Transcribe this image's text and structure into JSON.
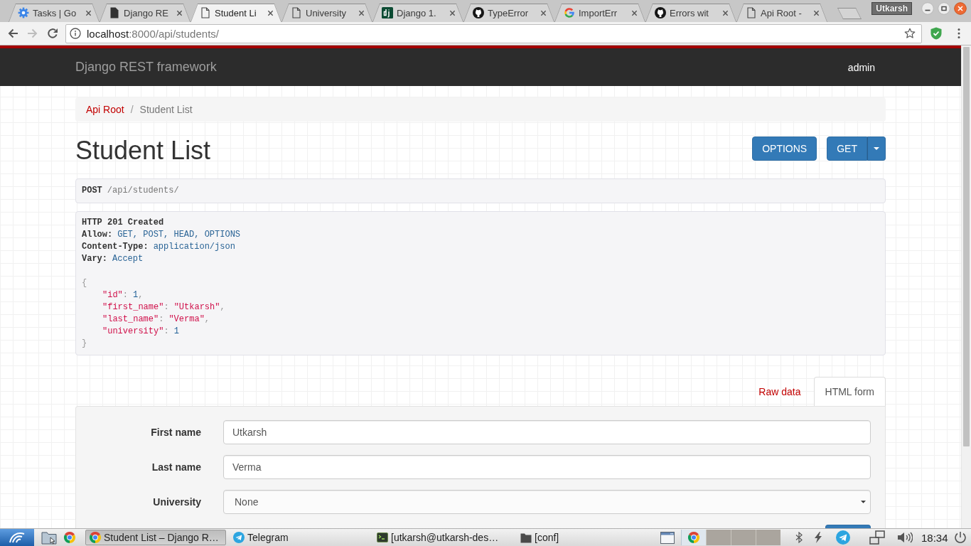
{
  "browser": {
    "tabs": [
      {
        "title": "Tasks | Go",
        "kind": "gear",
        "selected": false
      },
      {
        "title": "Django RE",
        "kind": "doc-filled",
        "selected": false
      },
      {
        "title": "Student Li",
        "kind": "doc",
        "selected": true
      },
      {
        "title": "University",
        "kind": "doc",
        "selected": false
      },
      {
        "title": "Django 1.",
        "kind": "tile",
        "selected": false
      },
      {
        "title": "TypeError",
        "kind": "cat",
        "selected": false
      },
      {
        "title": "ImportErr",
        "kind": "g",
        "selected": false
      },
      {
        "title": "Errors wit",
        "kind": "cat",
        "selected": false
      },
      {
        "title": "Api Root -",
        "kind": "doc",
        "selected": false
      }
    ],
    "profile": "Utkarsh",
    "nav_buttons": [
      {
        "kind": "back",
        "disabled": false
      },
      {
        "kind": "forward",
        "disabled": true
      },
      {
        "kind": "reload",
        "disabled": false
      }
    ],
    "url": {
      "host": "localhost",
      "path": ":8000/api/students/"
    }
  },
  "navbar": {
    "brand": "Django REST framework",
    "user": "admin"
  },
  "breadcrumbs": [
    {
      "label": "Api Root",
      "kind": "link"
    },
    {
      "label": "/",
      "kind": "separator"
    },
    {
      "label": "Student List",
      "kind": "current"
    }
  ],
  "page_title": "Student List",
  "actions": [
    {
      "label": "OPTIONS",
      "kind": "button"
    },
    {
      "label": "GET",
      "kind": "split"
    }
  ],
  "request": {
    "method": "POST",
    "path": "/api/students/"
  },
  "response": {
    "status": "HTTP 201 Created",
    "headers": [
      {
        "name": "Allow:",
        "value": "GET, POST, HEAD, OPTIONS"
      },
      {
        "name": "Content-Type:",
        "value": "application/json"
      },
      {
        "name": "Vary:",
        "value": "Accept"
      }
    ],
    "body": {
      "open": "{",
      "fields": [
        {
          "key": "\"id\"",
          "colon": ":",
          "value": "1",
          "kind": "number",
          "comma": ","
        },
        {
          "key": "\"first_name\"",
          "colon": ":",
          "value": "\"Utkarsh\"",
          "kind": "string",
          "comma": ","
        },
        {
          "key": "\"last_name\"",
          "colon": ":",
          "value": "\"Verma\"",
          "kind": "string",
          "comma": ","
        },
        {
          "key": "\"university\"",
          "colon": ":",
          "value": "1",
          "kind": "number"
        }
      ],
      "close": "}"
    }
  },
  "form_tabs": [
    {
      "label": "Raw data",
      "selected": false
    },
    {
      "label": "HTML form",
      "selected": true
    }
  ],
  "form": {
    "fields": [
      {
        "label": "First name",
        "kind": "text",
        "value": "Utkarsh"
      },
      {
        "label": "Last name",
        "kind": "text",
        "value": "Verma"
      },
      {
        "label": "University",
        "kind": "select",
        "value": "None"
      }
    ]
  },
  "taskbar": {
    "tasks": [
      {
        "title": "Student List – Django R…",
        "kind": "browser",
        "selected": true
      },
      {
        "title": "Telegram",
        "kind": "messenger",
        "selected": false
      },
      {
        "title": "[utkarsh@utkarsh-des…",
        "kind": "terminal",
        "selected": false
      },
      {
        "title": "[conf]",
        "kind": "file-manager",
        "selected": false
      }
    ],
    "pager": [
      {
        "kind": "browser",
        "selected": true
      },
      {
        "kind": "empty",
        "selected": false
      },
      {
        "kind": "empty",
        "selected": false
      },
      {
        "kind": "empty",
        "selected": false
      }
    ],
    "clock": "18:34"
  }
}
